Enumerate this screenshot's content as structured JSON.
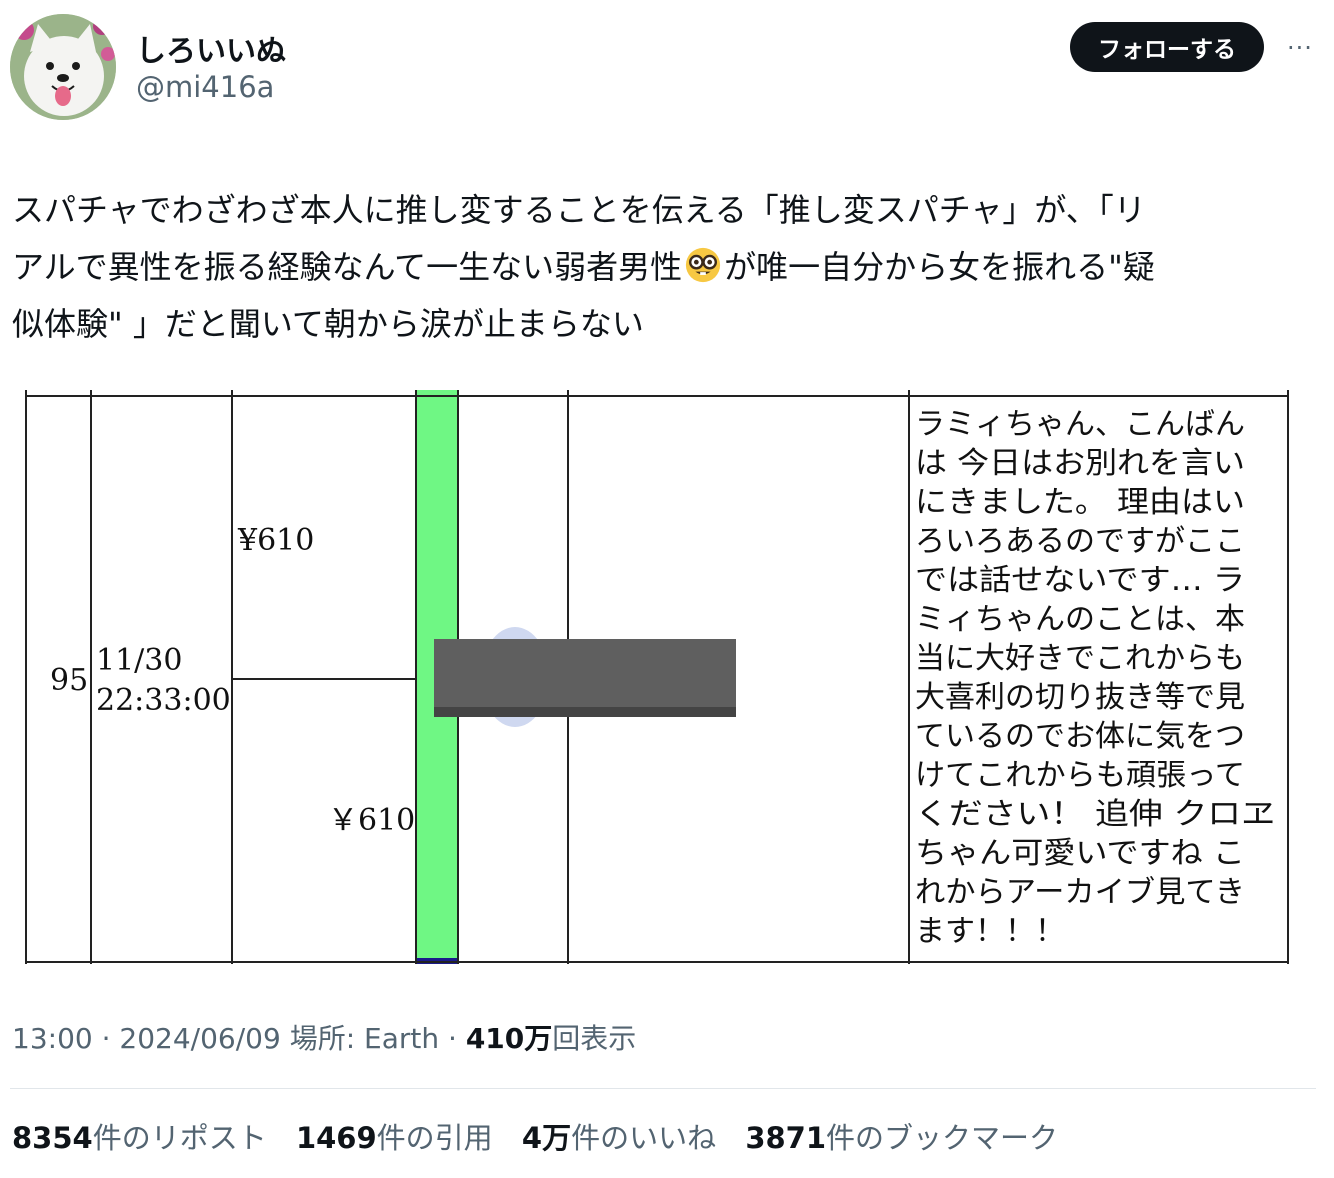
{
  "author": {
    "display_name": "しろいいぬ",
    "handle": "@mi416a",
    "avatar_icon": "samoyed-dog-avatar"
  },
  "actions": {
    "follow_label": "フォローする",
    "more_label": "···"
  },
  "tweet": {
    "line1": "スパチャでわざわざ本人に推し変することを伝える「推し変スパチャ」が、「リ",
    "line2_before_emoji": "アルで異性を振る経験なんて一生ない弱者男性",
    "emoji": "nerd-face-emoji",
    "line2_after_emoji": "が唯一自分から女を振れる\"疑",
    "line3": "似体験\" 」だと聞いて朝から涙が止まらない"
  },
  "media_table": {
    "row_number": "95",
    "date": "11/30",
    "time": "22:33:00",
    "amount_top": "¥610",
    "amount_bottom": "￥610",
    "bar_color": "#6ff784",
    "message_lines": [
      "ラミィちゃん、こんばん",
      "は 今日はお別れを言い",
      "にきました。 理由はい",
      "ろいろあるのですがここ",
      "では話せないです… ラ",
      "ミィちゃんのことは、本",
      "当に大好きでこれからも",
      "大喜利の切り抜き等で見",
      "ているのでお体に気をつ",
      "けてこれからも頑張って",
      "ください！ 追伸 クロヱ",
      "ちゃん可愛いですね こ",
      "れからアーカイブ見てき",
      "ます！！！"
    ]
  },
  "meta": {
    "time": "13:00",
    "sep1": " · ",
    "date": "2024/06/09",
    "location": " 場所: Earth",
    "sep2": " · ",
    "views_num": "410万",
    "views_label": "回表示"
  },
  "stats": [
    {
      "num": "8354",
      "label": "件のリポスト"
    },
    {
      "num": "1469",
      "label": "件の引用"
    },
    {
      "num": "4万",
      "label": "件のいいね"
    },
    {
      "num": "3871",
      "label": "件のブックマーク"
    }
  ]
}
